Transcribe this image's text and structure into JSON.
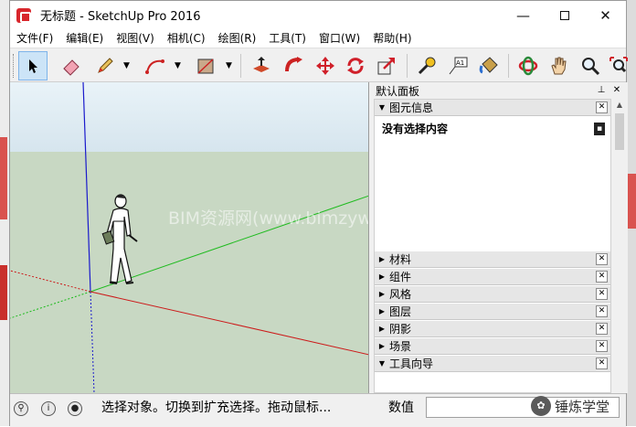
{
  "window": {
    "title": "无标题 - SketchUp Pro 2016"
  },
  "window_controls": {
    "minimize": "—",
    "maximize": "",
    "close": "✕"
  },
  "menu": {
    "items": [
      "文件(F)",
      "编辑(E)",
      "视图(V)",
      "相机(C)",
      "绘图(R)",
      "工具(T)",
      "窗口(W)",
      "帮助(H)"
    ]
  },
  "toolbar": {
    "tools": [
      "select-icon",
      "eraser-icon",
      "pencil-icon",
      "arc-icon",
      "rectangle-icon",
      "push-pull-icon",
      "follow-me-icon",
      "move-icon",
      "rotate-icon",
      "scale-icon",
      "tape-measure-icon",
      "text-icon",
      "paint-bucket-icon",
      "orbit-icon",
      "pan-icon",
      "zoom-icon",
      "zoom-extents-icon"
    ],
    "text_tool_label": "A1"
  },
  "viewport": {
    "watermark": "BIM资源网(www.bimzyw.com)",
    "sky_color": "#dbe9f2",
    "ground_color": "#c8d8c3",
    "axis_colors": {
      "red": "#cc0000",
      "green": "#00bb00",
      "blue": "#0000cc"
    }
  },
  "tray": {
    "title": "默认面板",
    "pin": "⊥",
    "close": "✕",
    "entity_info": {
      "label": "图元信息",
      "content": "没有选择内容",
      "button": "▪"
    },
    "panels": [
      "材料",
      "组件",
      "风格",
      "图层",
      "阴影",
      "场景",
      "工具向导"
    ],
    "close_glyph": "✕",
    "collapsed_arrow": "▶",
    "expanded_arrow": "▼"
  },
  "statusbar": {
    "icons": [
      "geo-location-icon",
      "info-icon",
      "user-icon"
    ],
    "message": "选择对象。切换到扩充选择。拖动鼠标...",
    "measurements_label": "数值",
    "measurements_value": "",
    "watermark_logo": "✿",
    "watermark_text": "锤炼学堂"
  }
}
